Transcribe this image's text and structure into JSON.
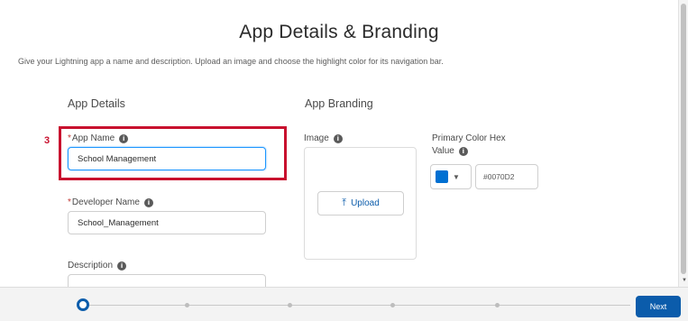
{
  "header": {
    "title": "App Details & Branding",
    "subtitle": "Give your Lightning app a name and description. Upload an image and choose the highlight color for its navigation bar."
  },
  "details": {
    "heading": "App Details",
    "app_name": {
      "label": "App Name",
      "value": "School Management"
    },
    "developer_name": {
      "label": "Developer Name",
      "value": "School_Management"
    },
    "description": {
      "label": "Description"
    }
  },
  "branding": {
    "heading": "App Branding",
    "image_label": "Image",
    "upload_label": "Upload",
    "color_label_line1": "Primary Color Hex",
    "color_label_line2": "Value",
    "hex_value": "#0070D2",
    "swatch_color": "#0070d2"
  },
  "annotation": {
    "step_number": "3"
  },
  "footer": {
    "next_label": "Next"
  },
  "icons": {
    "info": "info-icon",
    "upload": "upload-icon",
    "caret": "chevron-down-icon"
  }
}
